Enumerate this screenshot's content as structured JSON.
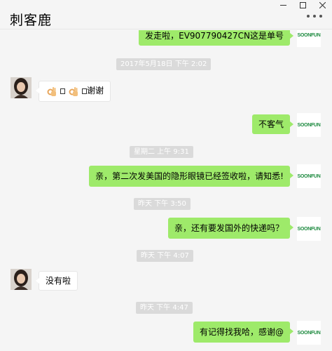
{
  "window": {
    "title": "刺客鹿"
  },
  "brand_avatar": "SOONFUN",
  "messages": [
    {
      "id": "m0",
      "side": "right",
      "text": "发走啦，EV907790427CN这是单号"
    },
    {
      "id": "t1",
      "type": "time",
      "text": "2017年5月18日 下午 2:02"
    },
    {
      "id": "m1",
      "side": "left",
      "text_suffix": "谢谢"
    },
    {
      "id": "m2",
      "side": "right",
      "text": "不客气"
    },
    {
      "id": "t2",
      "type": "time",
      "text": "星期二 上午 9:31"
    },
    {
      "id": "m3",
      "side": "right",
      "text": "亲，第二次发美国的隐形眼镜已经签收啦，请知悉!"
    },
    {
      "id": "t3",
      "type": "time",
      "text": "昨天 下午 3:50"
    },
    {
      "id": "m4",
      "side": "right",
      "text": "亲，还有要发国外的快递吗？"
    },
    {
      "id": "t4",
      "type": "time",
      "text": "昨天 下午 4:07"
    },
    {
      "id": "m5",
      "side": "left",
      "text": "没有啦"
    },
    {
      "id": "t5",
      "type": "time",
      "text": "昨天 下午 4:47"
    },
    {
      "id": "m6",
      "side": "right",
      "text": "有记得找我哈，感谢@"
    }
  ],
  "icons": {
    "minimize": "minimize-icon",
    "maximize": "maximize-icon",
    "close": "close-icon",
    "more": "more-icon",
    "ok_hand": "ok-hand-icon"
  },
  "colors": {
    "bubble_right": "#9eea6a",
    "bubble_left": "#ffffff",
    "time_badge": "#dadada",
    "brand": "#1d8a3f"
  }
}
